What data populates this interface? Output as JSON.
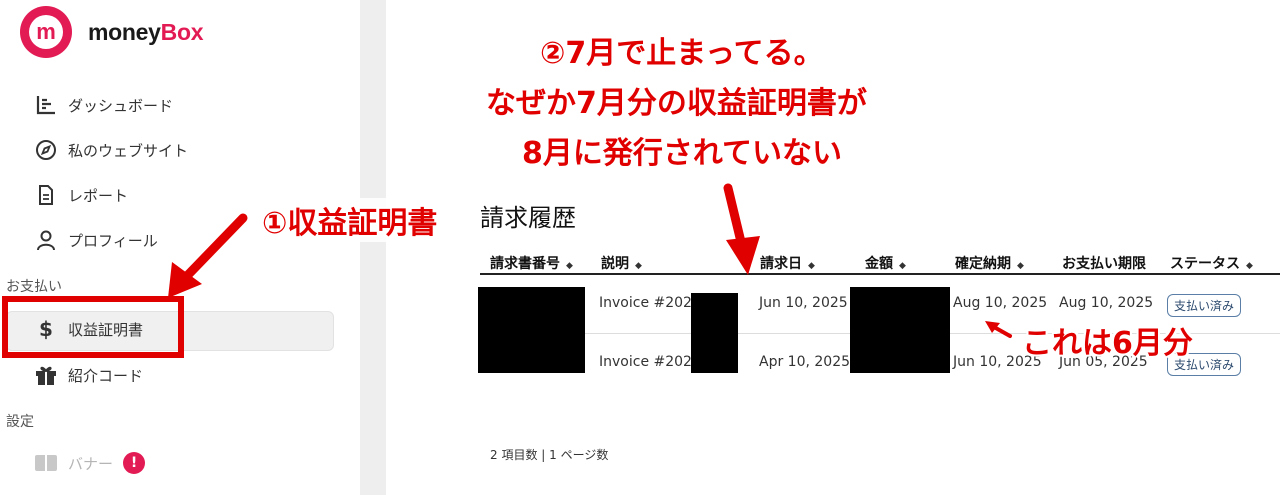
{
  "brand": {
    "mark": "m",
    "name_part1": "money",
    "name_part2": "Box",
    "accent": "#e31b54"
  },
  "sidebar": {
    "items": [
      {
        "label": "ダッシュボード",
        "icon": "bar-chart-icon"
      },
      {
        "label": "私のウェブサイト",
        "icon": "compass-icon"
      },
      {
        "label": "レポート",
        "icon": "document-icon"
      },
      {
        "label": "プロフィール",
        "icon": "user-icon"
      }
    ],
    "section_payment": "お支払い",
    "payment_items": [
      {
        "label": "収益証明書",
        "icon": "dollar-icon",
        "active": true
      },
      {
        "label": "紹介コード",
        "icon": "gift-icon"
      }
    ],
    "section_settings": "設定",
    "settings_items": [
      {
        "label": "バナー",
        "icon": "banner-icon",
        "disabled": true,
        "alert": "!"
      }
    ]
  },
  "main": {
    "title": "請求履歴",
    "columns": [
      {
        "label": "請求書番号"
      },
      {
        "label": "説明"
      },
      {
        "label": "請求日"
      },
      {
        "label": "金額"
      },
      {
        "label": "確定納期"
      },
      {
        "label": "お支払い期限"
      },
      {
        "label": "ステータス"
      }
    ],
    "sort_glyph": "◆",
    "rows": [
      {
        "description": "Invoice #2025",
        "invoice_date": "Jun 10, 2025",
        "confirmed_date": "Aug 10, 2025",
        "due_date": "Aug 10, 2025",
        "status": "支払い済み"
      },
      {
        "description": "Invoice #2025",
        "invoice_date": "Apr 10, 2025",
        "confirmed_date": "Jun 10, 2025",
        "due_date": "Jun 05, 2025",
        "status": "支払い済み"
      }
    ],
    "footer": "2 項目数 | 1 ページ数"
  },
  "annotations": {
    "note1": "①収益証明書",
    "note2_line1": "②7月で止まってる。",
    "note2_line2": "なぜか7月分の収益証明書が",
    "note2_line3": "8月に発行されていない",
    "note3": "これは6月分",
    "color": "#e00000"
  }
}
